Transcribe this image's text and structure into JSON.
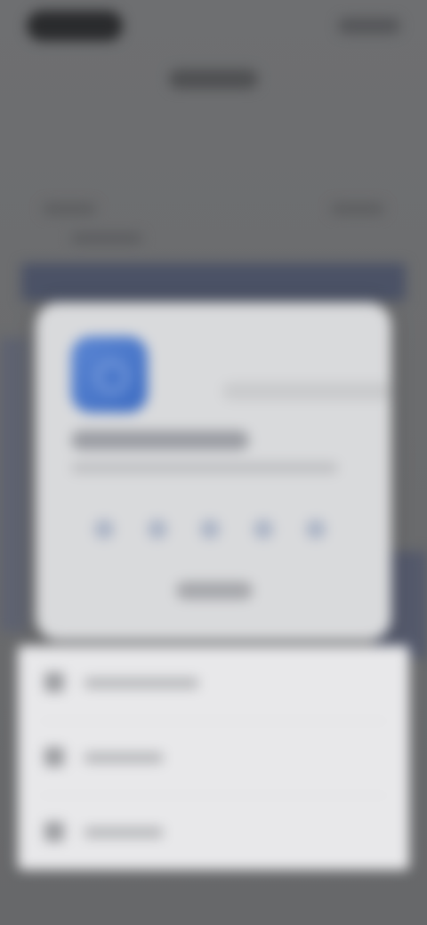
{
  "status_bar": {
    "time": "",
    "indicators": ""
  },
  "nav": {
    "title": ""
  },
  "background_rows": {
    "left_label": "",
    "right_label": "",
    "sub_label": ""
  },
  "popup": {
    "app_icon": "app-icon",
    "title": "",
    "description": "",
    "pin_digits": 5,
    "button_label": ""
  },
  "sheet": {
    "items": [
      {
        "icon": "list-icon",
        "label": ""
      },
      {
        "icon": "bookmark-icon",
        "label": ""
      },
      {
        "icon": "trash-icon",
        "label": ""
      }
    ]
  },
  "colors": {
    "app_icon_blue": "#4a78cb",
    "overlay_gray": "#6f7072",
    "card_bg": "#d9dadc",
    "sheet_bg": "#e8e8ea"
  }
}
